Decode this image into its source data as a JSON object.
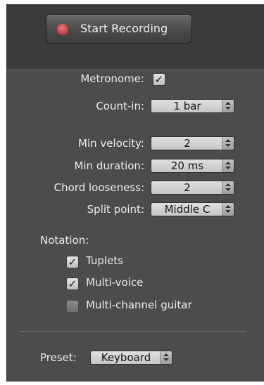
{
  "record_button": {
    "label": "Start Recording"
  },
  "metronome": {
    "label": "Metronome:",
    "checked": true
  },
  "count_in": {
    "label": "Count-in:",
    "value": "1 bar"
  },
  "min_velocity": {
    "label": "Min velocity:",
    "value": "2"
  },
  "min_duration": {
    "label": "Min duration:",
    "value": "20 ms"
  },
  "chord_looseness": {
    "label": "Chord looseness:",
    "value": "2"
  },
  "split_point": {
    "label": "Split point:",
    "value": "Middle C"
  },
  "notation": {
    "heading": "Notation:",
    "tuplets": {
      "label": "Tuplets",
      "checked": true
    },
    "multi_voice": {
      "label": "Multi-voice",
      "checked": true
    },
    "multi_channel_guitar": {
      "label": "Multi-channel guitar",
      "checked": false
    }
  },
  "preset": {
    "label": "Preset:",
    "value": "Keyboard"
  },
  "colors": {
    "record_dot": "#d04545",
    "panel_bg": "#4c4c4c"
  }
}
